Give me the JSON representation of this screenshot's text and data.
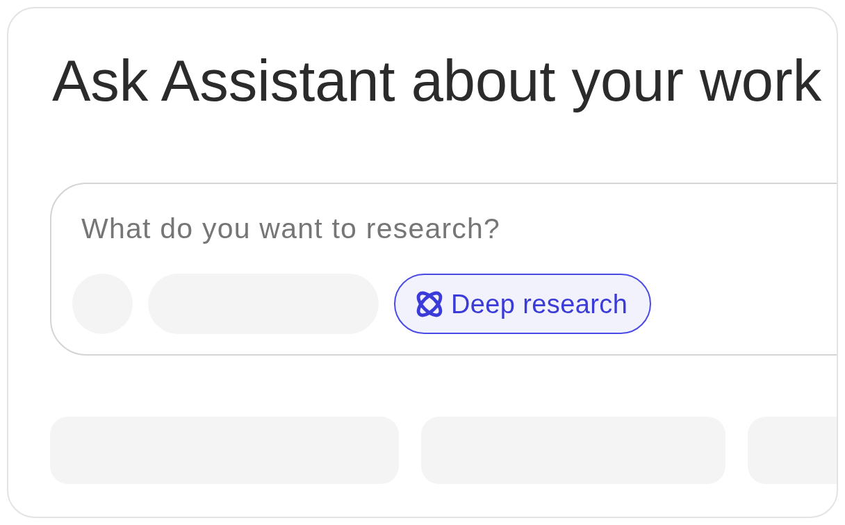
{
  "heading": "Ask Assistant about your work",
  "composer": {
    "placeholder": "What do you want to research?",
    "deep_research": {
      "label": "Deep research",
      "selected": true
    }
  }
}
